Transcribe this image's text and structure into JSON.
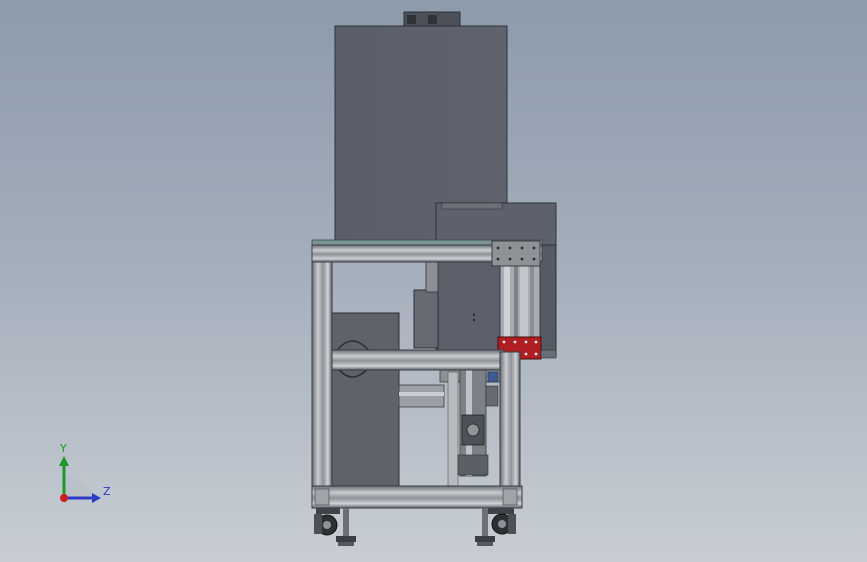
{
  "viewport": {
    "background_top": "#8d9bad",
    "background_bottom": "#c8cdd3"
  },
  "model": {
    "view": "side",
    "colors": {
      "cabinet": "#5c606b",
      "frame": "#9aa0a6",
      "frame_dark": "#4b4f55",
      "plate_red": "#b01e22",
      "plate_gray": "#8e9296"
    }
  },
  "triad": {
    "y_label": "Y",
    "z_label": "Z",
    "y_color": "#1b9a2a",
    "z_color": "#2a3cc8",
    "x_color": "#c81e1e"
  }
}
